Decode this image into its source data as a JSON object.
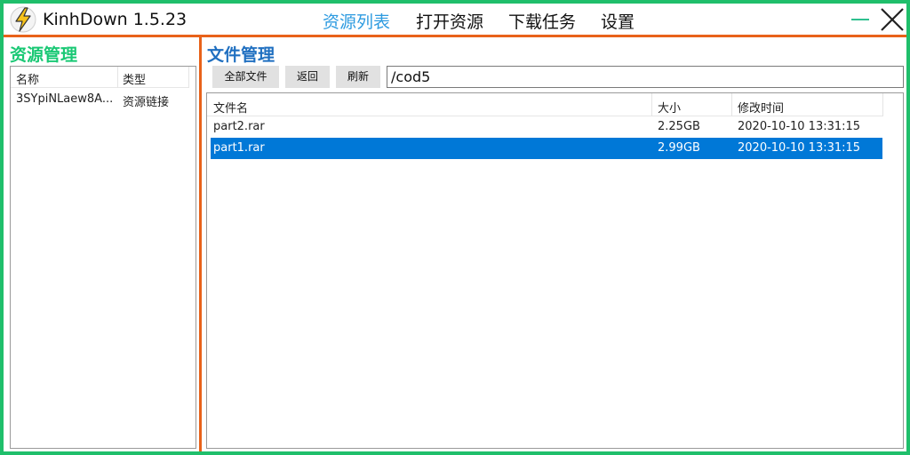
{
  "app": {
    "title": "KinhDown 1.5.23"
  },
  "nav": {
    "items": [
      {
        "label": "资源列表",
        "active": true
      },
      {
        "label": "打开资源",
        "active": false
      },
      {
        "label": "下载任务",
        "active": false
      },
      {
        "label": "设置",
        "active": false
      }
    ]
  },
  "icons": {
    "app": "lightning-bolt-icon",
    "minimize": "minimize-icon",
    "close": "close-icon"
  },
  "colors": {
    "frame": "#1fbf6b",
    "accent_line": "#e8621a",
    "nav_active": "#2e9be0",
    "left_title": "#19c874",
    "right_title": "#1f6fc0",
    "selection": "#0078d7"
  },
  "resources": {
    "title": "资源管理",
    "columns": [
      "名称",
      "类型"
    ],
    "rows": [
      {
        "name": "3SYpiNLaew8A...",
        "type": "资源链接"
      }
    ]
  },
  "files": {
    "title": "文件管理",
    "buttons": {
      "all_files": "全部文件",
      "back": "返回",
      "refresh": "刷新"
    },
    "path": "/cod5",
    "columns": [
      "文件名",
      "大小",
      "修改时间"
    ],
    "rows": [
      {
        "name": "part2.rar",
        "size": "2.25GB",
        "modified": "2020-10-10 13:31:15",
        "selected": false
      },
      {
        "name": "part1.rar",
        "size": "2.99GB",
        "modified": "2020-10-10 13:31:15",
        "selected": true
      }
    ]
  }
}
